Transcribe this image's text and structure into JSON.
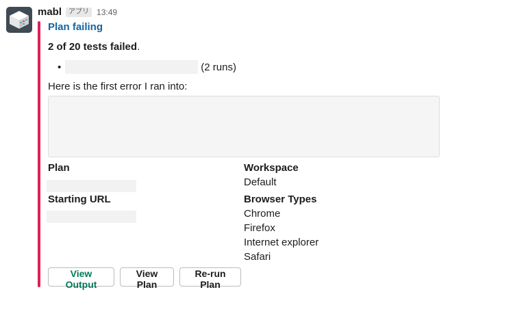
{
  "message": {
    "sender": "mabl",
    "app_badge": "アプリ",
    "time": "13:49",
    "title": "Plan failing",
    "summary": "2 of 20 tests failed",
    "summary_period": ".",
    "bullet_runs": "(2 runs)",
    "intro": "Here is the first error I ran into:",
    "accent_color": "#e01e5a"
  },
  "fields": {
    "plan_label": "Plan",
    "starting_url_label": "Starting URL",
    "workspace_label": "Workspace",
    "workspace_value": "Default",
    "browser_types_label": "Browser Types",
    "browser_types": [
      "Chrome",
      "Firefox",
      "Internet explorer",
      "Safari"
    ]
  },
  "actions": {
    "view_output": "View Output",
    "view_plan": "View Plan",
    "rerun_plan": "Re-run Plan"
  },
  "icons": {
    "avatar": "mabl-logo-icon"
  }
}
